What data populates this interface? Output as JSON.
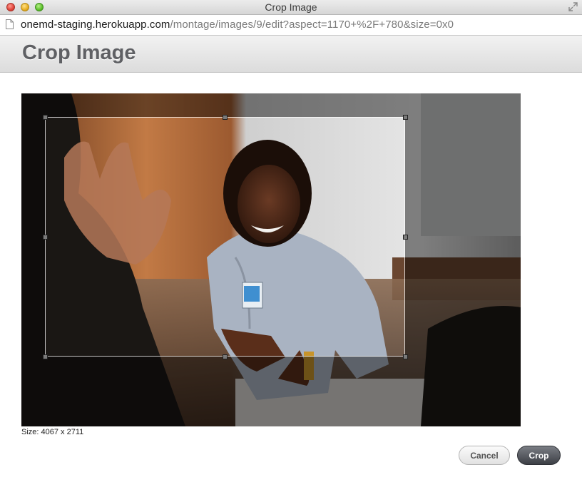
{
  "window": {
    "title": "Crop Image",
    "controls": [
      "close",
      "minimize",
      "zoom"
    ]
  },
  "address_bar": {
    "host": "onemd-staging.herokuapp.com",
    "path": "/montage/images/9/edit?aspect=1170+%2F+780&size=0x0"
  },
  "page": {
    "title": "Crop Image"
  },
  "image": {
    "description_icon": "photo",
    "size_label": "Size: 4067 x 2711"
  },
  "actions": {
    "cancel_label": "Cancel",
    "crop_label": "Crop"
  },
  "colors": {
    "crop_button": "#4a4d53",
    "header_title": "#5f6064"
  }
}
